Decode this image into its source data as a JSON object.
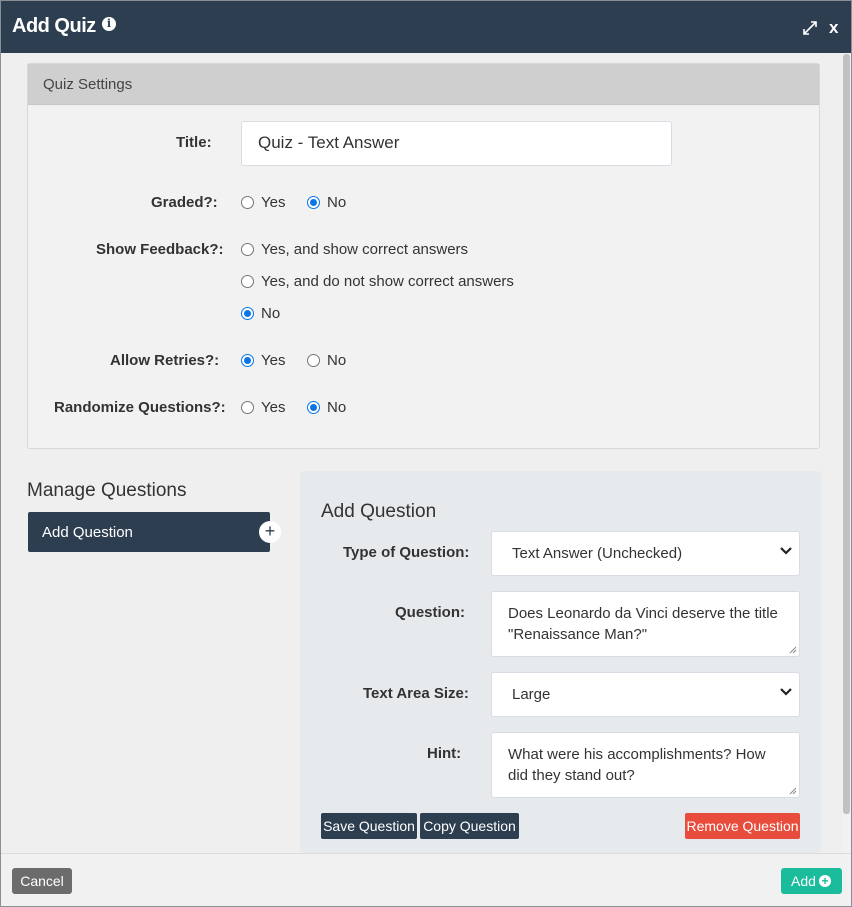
{
  "window": {
    "title": "Add Quiz",
    "close_label": "x",
    "info_icon": "info-icon",
    "expand_icon": "expand-icon"
  },
  "settings": {
    "header": "Quiz Settings",
    "title_label": "Title:",
    "title_value": "Quiz - Text Answer",
    "graded": {
      "label": "Graded?:",
      "options": [
        "Yes",
        "No"
      ],
      "selected": "No"
    },
    "show_feedback": {
      "label": "Show Feedback?:",
      "options": [
        "Yes, and show correct answers",
        "Yes, and do not show correct answers",
        "No"
      ],
      "selected": "No"
    },
    "allow_retries": {
      "label": "Allow Retries?:",
      "options": [
        "Yes",
        "No"
      ],
      "selected": "Yes"
    },
    "randomize": {
      "label": "Randomize Questions?:",
      "options": [
        "Yes",
        "No"
      ],
      "selected": "No"
    }
  },
  "manage": {
    "title": "Manage Questions",
    "add_button": "Add Question",
    "add_icon": "plus-icon"
  },
  "question": {
    "heading": "Add Question",
    "type_label": "Type of Question:",
    "type_value": "Text Answer (Unchecked)",
    "question_label": "Question:",
    "question_value": "Does Leonardo da Vinci deserve the title \"Renaissance Man?\"",
    "size_label": "Text Area Size:",
    "size_value": "Large",
    "hint_label": "Hint:",
    "hint_value": "What were his accomplishments? How did they stand out?",
    "save_button": "Save Question",
    "copy_button": "Copy Question",
    "remove_button": "Remove Question"
  },
  "footer": {
    "cancel": "Cancel",
    "add": "Add"
  },
  "colors": {
    "navy": "#2d3e50",
    "radio_blue": "#0a75e5",
    "danger": "#e74c3c",
    "success": "#1abc9c",
    "cancel": "#6c6c6c"
  }
}
